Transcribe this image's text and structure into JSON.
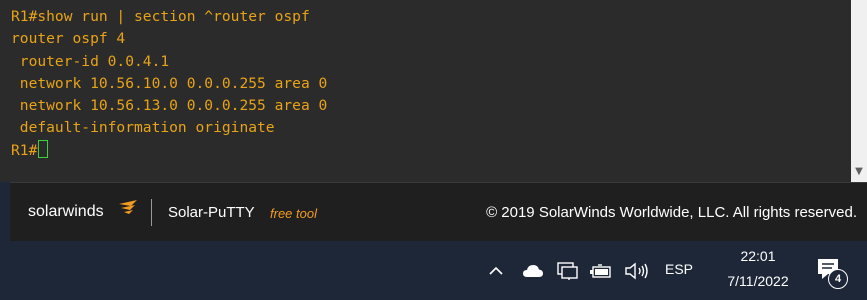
{
  "terminal": {
    "lines": [
      "R1#show run | section ^router ospf",
      "router ospf 4",
      " router-id 0.0.4.1",
      " network 10.56.10.0 0.0.0.255 area 0",
      " network 10.56.13.0 0.0.0.255 area 0",
      " default-information originate"
    ],
    "prompt": "R1#",
    "text_color": "#e8a317",
    "cursor_color": "#3cd23c"
  },
  "footer": {
    "brand": "solarwinds",
    "product": "Solar-PuTTY",
    "product_tag": "free tool",
    "copyright": "© 2019 SolarWinds Worldwide, LLC. All rights reserved.",
    "brand_accent_color": "#f29b20"
  },
  "taskbar": {
    "tray_icons": [
      "chevron-up-icon",
      "cloud-icon",
      "network-icon",
      "battery-icon",
      "speaker-icon"
    ],
    "language": "ESP",
    "time": "22:01",
    "date": "7/11/2022",
    "notification_count": "4"
  }
}
